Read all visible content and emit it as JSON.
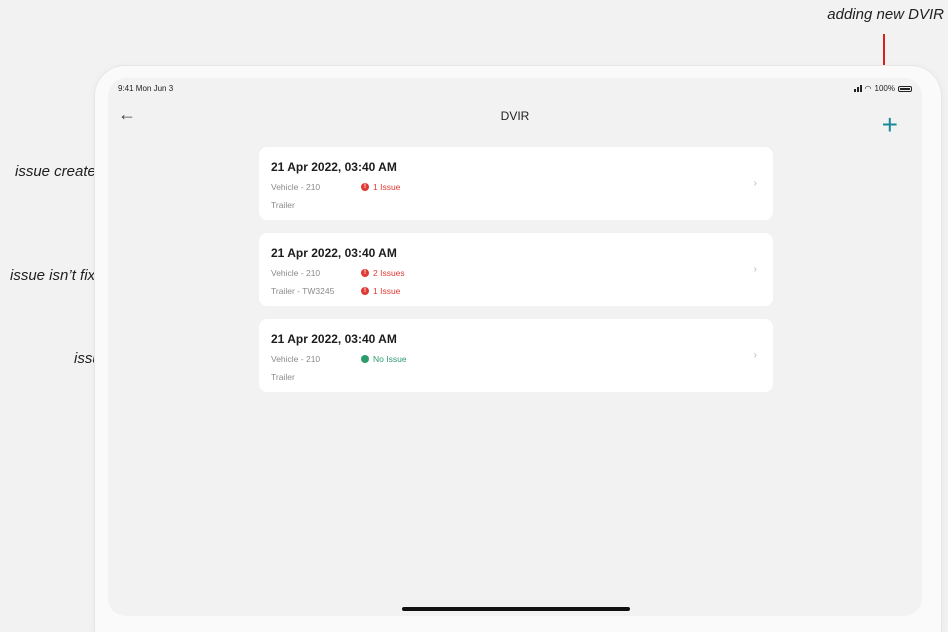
{
  "annotations": {
    "top": "adding new DVIR",
    "created_time": "issue created time",
    "not_fixed": "issue isn’t fixed yet",
    "fixed": "issue fixed"
  },
  "statusbar": {
    "time": "9:41 Mon Jun 3",
    "battery": "100%"
  },
  "nav": {
    "title": "DVIR",
    "back_icon": "arrow-left-icon",
    "add_icon": "plus-icon"
  },
  "colors": {
    "accent": "#1a8a9a",
    "issue": "#e03a36",
    "ok": "#2e9b6f",
    "annotation_arrow": "#d9211e"
  },
  "cards": [
    {
      "date": "21 Apr 2022, 03:40 AM",
      "vehicle": "Vehicle - 210",
      "vehicle_status": "1 Issue",
      "trailer": "Trailer",
      "trailer_status": ""
    },
    {
      "date": "21 Apr 2022, 03:40 AM",
      "vehicle": "Vehicle - 210",
      "vehicle_status": "2 Issues",
      "trailer": "Trailer - TW3245",
      "trailer_status": "1 Issue"
    },
    {
      "date": "21 Apr 2022, 03:40 AM",
      "vehicle": "Vehicle - 210",
      "vehicle_status": "No Issue",
      "trailer": "Trailer",
      "trailer_status": ""
    }
  ]
}
